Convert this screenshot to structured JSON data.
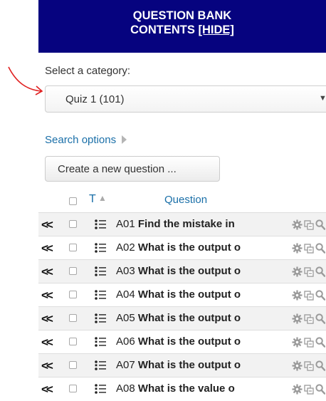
{
  "header": {
    "title_line1": "QUESTION BANK",
    "title_line2": "CONTENTS",
    "hide_link": "[HIDE]"
  },
  "category": {
    "label": "Select a category:",
    "selected": "Quiz 1 (101)"
  },
  "search_options": "Search options",
  "create_button": "Create a new question ...",
  "table": {
    "type_header": "T",
    "question_header": "Question",
    "rows": [
      {
        "id": "A01",
        "text": "Find the mistake in"
      },
      {
        "id": "A02",
        "text": "What is the output o"
      },
      {
        "id": "A03",
        "text": "What is the output o"
      },
      {
        "id": "A04",
        "text": "What is the output o"
      },
      {
        "id": "A05",
        "text": "What is the output o"
      },
      {
        "id": "A06",
        "text": "What is the output o"
      },
      {
        "id": "A07",
        "text": "What is the output o"
      },
      {
        "id": "A08",
        "text": "What is the value o"
      }
    ]
  },
  "colors": {
    "header_bg": "#06037f",
    "link": "#1a6fa8",
    "annotation": "#e02020"
  }
}
